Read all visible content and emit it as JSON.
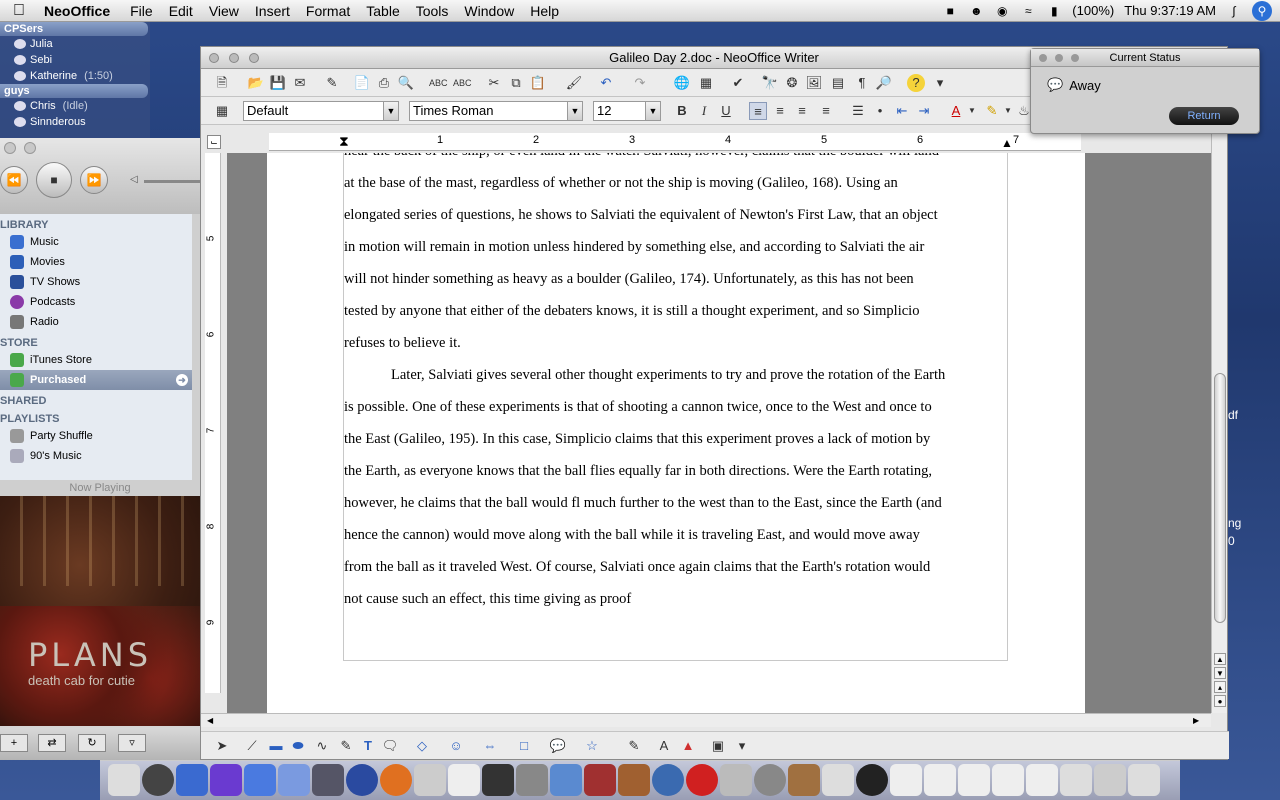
{
  "menubar": {
    "app_name": "NeoOffice",
    "items": [
      "File",
      "Edit",
      "View",
      "Insert",
      "Format",
      "Table",
      "Tools",
      "Window",
      "Help"
    ],
    "battery": "(100%)",
    "clock": "Thu 9:37:19 AM"
  },
  "buddy_list": {
    "groups": [
      {
        "name": "CPSers",
        "buddies": [
          {
            "name": "Julia",
            "status": ""
          },
          {
            "name": "Sebi",
            "status": ""
          },
          {
            "name": "Katherine",
            "status": "(1:50)"
          }
        ]
      },
      {
        "name": "guys",
        "buddies": [
          {
            "name": "Chris",
            "status": "(Idle)"
          },
          {
            "name": "Sinnderous",
            "status": ""
          }
        ]
      }
    ]
  },
  "itunes": {
    "sections": {
      "library": "LIBRARY",
      "store": "STORE",
      "shared": "SHARED",
      "playlists": "PLAYLISTS"
    },
    "library_items": [
      "Music",
      "Movies",
      "TV Shows",
      "Podcasts",
      "Radio"
    ],
    "store_items": [
      "iTunes Store",
      "Purchased"
    ],
    "playlist_items": [
      "Party Shuffle",
      "90's Music"
    ],
    "now_playing": "Now Playing",
    "album_title": "PLANS",
    "album_artist": "death cab for cutie"
  },
  "writer": {
    "window_title": "Galileo Day 2.doc - NeoOffice Writer",
    "paragraph_style": "Default",
    "font_name": "Times Roman",
    "font_size": "12",
    "ruler_numbers": [
      "1",
      "2",
      "3",
      "4",
      "5",
      "6",
      "7"
    ],
    "vruler_numbers": [
      "5",
      "6",
      "7",
      "8",
      "9"
    ],
    "lines": [
      "near the back of the ship, or even land in the water. Salviati, however, claims that the boulder will land",
      "at the base of the mast, regardless of whether or not the ship is moving (Galileo, 168). Using an",
      "elongated series of questions, he shows to Salviati the equivalent of Newton's First Law, that an object",
      "in motion will remain in motion unless hindered by something else, and according to Salviati the air",
      "will not hinder something as heavy as a boulder (Galileo, 174). Unfortunately, as this has not been",
      "tested by anyone that either of the debaters knows, it is still a thought experiment, and so Simplicio",
      "refuses to believe it.",
      "Later, Salviati gives several other thought experiments to try and prove the rotation of the Earth",
      "is possible. One of these experiments is that of shooting a cannon twice, once to the West and once to",
      "the East (Galileo, 195). In this case, Simplicio claims that this experiment proves a lack of motion by",
      "the Earth, as everyone knows that the ball flies equally far in both directions. Were the Earth rotating,",
      "however, he claims that the ball would fl much further to the west than to the East, since the Earth (and",
      "hence the cannon) would move along with the ball while it is traveling East, and would move away",
      "from the ball as it traveled West. Of course, Salviati once again claims that the Earth's rotation would",
      "not cause such an effect, this time giving as proof"
    ]
  },
  "status_window": {
    "title": "Current Status",
    "status": "Away",
    "return_label": "Return"
  },
  "desktop": {
    "right_text_1": "df",
    "right_text_2": "ng",
    "right_text_3": "0"
  }
}
